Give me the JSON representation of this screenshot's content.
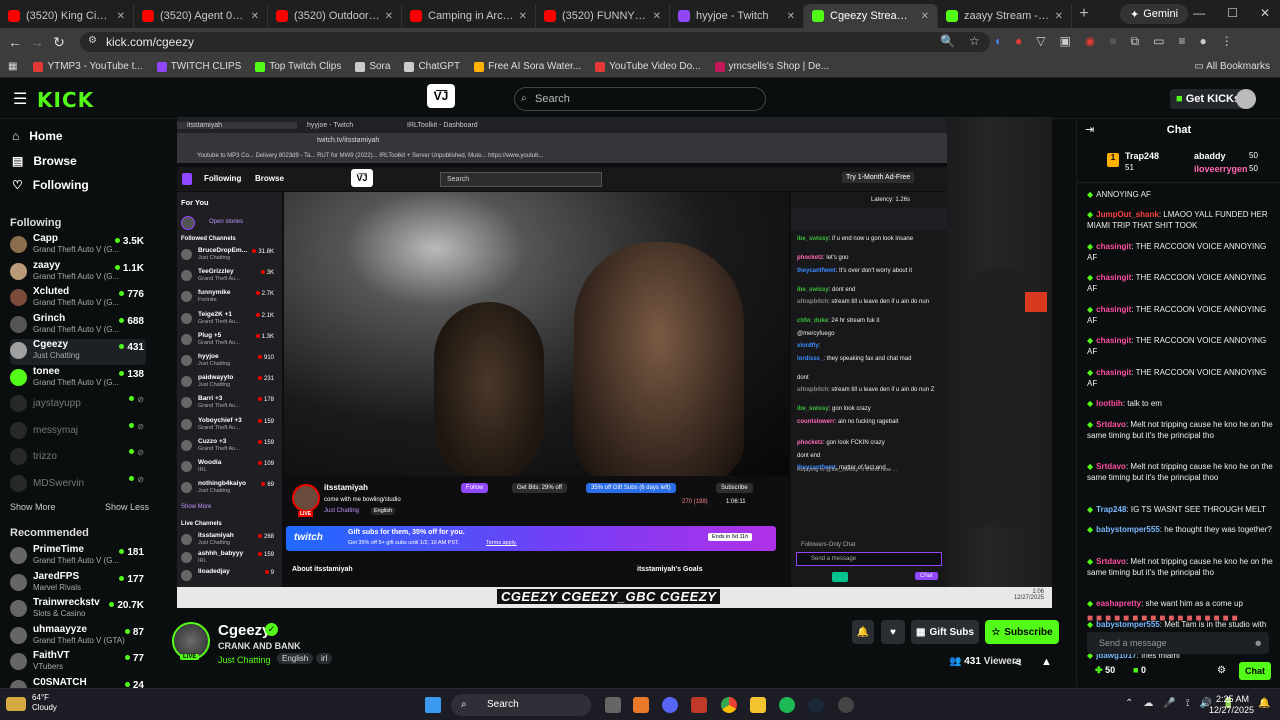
{
  "browser": {
    "tabs": [
      {
        "title": "(3520) King Cid - YouTube",
        "fav": "#ff0000"
      },
      {
        "title": "(3520) Agent 00 Everything",
        "fav": "#ff0000"
      },
      {
        "title": "(3520) Outdoor Boys - Y",
        "fav": "#ff0000"
      },
      {
        "title": "Camping in Arctic Circle",
        "fav": "#ff0000"
      },
      {
        "title": "(3520) FUNNYMIKE RE",
        "fav": "#ff0000"
      },
      {
        "title": "hyyjoe - Twitch",
        "fav": "#9146ff"
      },
      {
        "title": "Cgeezy Stream - W",
        "fav": "#53fc18"
      },
      {
        "title": "zaayy Stream - Watch L",
        "fav": "#53fc18"
      }
    ],
    "gemini": "Gemini",
    "url": "kick.com/cgeezy",
    "bookmarks": [
      {
        "label": "YTMP3 - YouTube t...",
        "c": "#e53935"
      },
      {
        "label": "TWITCH CLIPS",
        "c": "#9146ff"
      },
      {
        "label": "Top Twitch Clips",
        "c": "#53fc18"
      },
      {
        "label": "Sora",
        "c": "#ccc"
      },
      {
        "label": "ChatGPT",
        "c": "#ccc"
      },
      {
        "label": "Free AI Sora Water...",
        "c": "#ffb300"
      },
      {
        "label": "YouTube Video Do...",
        "c": "#e53935"
      },
      {
        "label": "ymcsells's Shop | De...",
        "c": "#c2185b"
      }
    ],
    "all_bookmarks": "All Bookmarks"
  },
  "kick": {
    "logo": "KICK",
    "search_placeholder": "Search",
    "get_kicks": "Get KICKs",
    "nav": {
      "home": "Home",
      "browse": "Browse",
      "following": "Following"
    },
    "following_header": "Following",
    "following": [
      {
        "name": "Capp",
        "game": "Grand Theft Auto V (G...",
        "viewers": "3.5K",
        "live": true
      },
      {
        "name": "zaayy",
        "game": "Grand Theft Auto V (G...",
        "viewers": "1.1K",
        "live": true
      },
      {
        "name": "Xcluted",
        "game": "Grand Theft Auto V (G...",
        "viewers": "776",
        "live": true
      },
      {
        "name": "Grinch",
        "game": "Grand Theft Auto V (G...",
        "viewers": "688",
        "live": true
      },
      {
        "name": "Cgeezy",
        "game": "Just Chatting",
        "viewers": "431",
        "live": true
      },
      {
        "name": "tonee",
        "game": "Grand Theft Auto V (G...",
        "viewers": "138",
        "live": true
      },
      {
        "name": "jaystayupp",
        "live": false
      },
      {
        "name": "messymaj",
        "live": false
      },
      {
        "name": "trizzo",
        "live": false
      },
      {
        "name": "MDSwervin",
        "live": false
      }
    ],
    "show_more": "Show More",
    "show_less": "Show Less",
    "recommended_header": "Recommended",
    "recommended": [
      {
        "name": "PrimeTime",
        "game": "Grand Theft Auto V (G...",
        "viewers": "181"
      },
      {
        "name": "JaredFPS",
        "game": "Marvel Rivals",
        "viewers": "177"
      },
      {
        "name": "Trainwreckstv",
        "game": "Slots & Casino",
        "viewers": "20.7K"
      },
      {
        "name": "uhmaayyze",
        "game": "Grand Theft Auto V (GTA)",
        "viewers": "87"
      },
      {
        "name": "FaithVT",
        "game": "VTubers",
        "viewers": "77"
      },
      {
        "name": "C0SNATCH",
        "game": "",
        "viewers": "24"
      }
    ]
  },
  "inner": {
    "tabs": [
      "hyyjoe - Twitch",
      "IRLToolkit - Dashboard",
      "itsstamiyah"
    ],
    "url": "twitch.tv/itsstamiyah",
    "bookmarks": "Youtube to MP3 Co...   Delivery 8023d9 - Ta...   RUT for MW9 (2022)...   IRLToolkit + Server   Unpublished, Mute...   https://www.youtub...",
    "following": "Following",
    "browse": "Browse",
    "search": "Search",
    "ad_free": "Try 1-Month Ad-Free",
    "for_you": "For You",
    "open_stories": "Open stories",
    "followed_channels": "Followed Channels",
    "live_channels": "Live Channels",
    "show_more": "Show More",
    "channels": [
      {
        "name": "BruceDropEm...",
        "game": "Just Chatting",
        "viewers": "31.8K"
      },
      {
        "name": "TeeGrizzley",
        "game": "Grand Theft Au...",
        "viewers": "3K"
      },
      {
        "name": "funnymike",
        "game": "Fortnite",
        "viewers": "2.7K"
      },
      {
        "name": "Teige2K +1",
        "game": "Grand Theft Au...",
        "viewers": "2.1K"
      },
      {
        "name": "Plug +5",
        "game": "Grand Theft Au...",
        "viewers": "1.3K"
      },
      {
        "name": "hyyjoe",
        "game": "Just Chatting",
        "viewers": "910"
      },
      {
        "name": "paidwayyto",
        "game": "Just Chatting",
        "viewers": "231"
      },
      {
        "name": "Barri +3",
        "game": "Grand Theft Au...",
        "viewers": "178"
      },
      {
        "name": "Yoboychief +3",
        "game": "Grand Theft Au...",
        "viewers": "159"
      },
      {
        "name": "Cuzzo +3",
        "game": "Grand Theft Au...",
        "viewers": "159"
      },
      {
        "name": "Woodia",
        "game": "IRL",
        "viewers": "109"
      },
      {
        "name": "nothingb4kaiyo",
        "game": "Just Chatting",
        "viewers": "69"
      }
    ],
    "live_list": [
      {
        "name": "itsstamiyah",
        "game": "Just Chatting",
        "viewers": "268"
      },
      {
        "name": "ashhh_babyyy",
        "game": "IRL",
        "viewers": "159"
      },
      {
        "name": "lloadedjay",
        "game": "",
        "viewers": "9"
      }
    ],
    "streamer": "itsstamiyah",
    "stream_title": "come with me bowling/studio",
    "category": "Just Chatting",
    "lang": "English",
    "follow": "Follow",
    "get_bits": "Get Bits: 29% off",
    "gift_subs": "35% off Gift Subs (6 days left)",
    "subscribe": "Subscribe",
    "viewers": "270 (198)",
    "uptime": "1:06:11",
    "banner_title": "Gift subs for them, 35% off for you.",
    "banner_sub": "Get 35% off 5+ gift subs until 1/2, 10 AM PST.",
    "banner_terms": "Terms apply.",
    "banner_ends": "Ends in 6d 11h",
    "about": "About itsstamiyah",
    "goals": "itsstamiyah's Goals",
    "latency": "Latency: 1.26s",
    "chat": [
      {
        "u": "ibe_swissy",
        "c": "#3bbd3b",
        "m": "if u end now u gon look insane"
      },
      {
        "u": "phocketz",
        "c": "#ff69b4",
        "m": "let's goo"
      },
      {
        "u": "theycantfwmt",
        "c": "#3a8bfd",
        "m": "It's over don't worry about it"
      },
      {
        "u": "ibe_swissy",
        "c": "#3bbd3b",
        "m": "dont end"
      },
      {
        "u": "ultrapbitch",
        "c": "#888",
        "m": "stream till u leave den if u ain do nun"
      },
      {
        "u": "cbfw_duke",
        "c": "#3bbd3b",
        "m": "24 hr stream fuk it"
      },
      {
        "u": "",
        "c": "#3a8bfd",
        "m": "@mercyfuego"
      },
      {
        "u": "xlordfly",
        "c": "#3a8bfd",
        "m": ""
      },
      {
        "u": "lordisss_",
        "c": "#3a8bfd",
        "m": "they speaking fax and chat mad"
      },
      {
        "u": "",
        "c": "#ff4040",
        "m": "dont"
      },
      {
        "u": "ultrapbitch",
        "c": "#888",
        "m": "stream till u leave den if u ain do nun Z"
      },
      {
        "u": "ibe_swissy",
        "c": "#3bbd3b",
        "m": "gon look crazy"
      },
      {
        "u": "countslowerr",
        "c": "#ff69b4",
        "m": "ain no fucking ragebait"
      },
      {
        "u": "phocketz",
        "c": "#ff69b4",
        "m": "gon look FCKIN crazy"
      },
      {
        "u": "",
        "c": "#ff4040",
        "m": "dont end"
      },
      {
        "u": "theycantfwmt",
        "c": "#3a8bfd",
        "m": "matter of fact end"
      }
    ],
    "reply_to": "Replying to @ibe_swissy: if u end now ...",
    "followers_only": "Followers-Only Chat",
    "send_message": "Send a message",
    "chat_btn": "Chat",
    "clock": "12:00\n12/27/2025"
  },
  "overlay_text": "CGEEZY  CGEEZY_GBC  CGEEZY",
  "stream": {
    "name": "Cgeezy",
    "title": "CRANK AND BANK",
    "category": "Just Chatting",
    "tags": [
      "English",
      "irl"
    ],
    "gift_subs": "Gift Subs",
    "subscribe": "Subscribe",
    "viewers": "431",
    "viewers_label": "Viewers",
    "live": "LIVE"
  },
  "chat": {
    "header": "Chat",
    "pinned": [
      {
        "rank": "1",
        "name": "Trap248",
        "count": "51"
      },
      {
        "name": "abaddy",
        "count": "50"
      },
      {
        "name": "iloveerrygen",
        "count": "50"
      }
    ],
    "messages": [
      {
        "u": "",
        "c": "#53fc18",
        "m": "ANNOYING AF"
      },
      {
        "u": "JumpOut_shank",
        "c": "#ff4040",
        "m": "LMAOO YALL FUNDED HER MIAMI TRIP THAT SHIT TOOK"
      },
      {
        "u": "chasingit",
        "c": "#ff4fa0",
        "m": "THE RACCOON VOICE ANNOYING AF"
      },
      {
        "u": "chasingit",
        "c": "#ff4fa0",
        "m": "THE RACCOON VOICE ANNOYING AF"
      },
      {
        "u": "chasingit",
        "c": "#ff4fa0",
        "m": "THE RACCOON VOICE ANNOYING AF"
      },
      {
        "u": "chasingit",
        "c": "#ff4fa0",
        "m": "THE RACCOON VOICE ANNOYING AF"
      },
      {
        "u": "chasingit",
        "c": "#ff4fa0",
        "m": "THE RACCOON VOICE ANNOYING AF"
      },
      {
        "u": "lootbih",
        "c": "#ff4fa0",
        "m": "talk to em"
      },
      {
        "u": "Srtdavo",
        "c": "#ff4fa0",
        "m": "Melt not tripping cause he kno he on the same timing but it's the principal tho"
      },
      {
        "u": "Srtdavo",
        "c": "#ff4fa0",
        "m": "Melt not tripping cause he kno he on the same timing but it's the principal thoo"
      },
      {
        "u": "Trap248",
        "c": "#7ab8ff",
        "m": "IG TS WASNT SEE THROUGH MELT"
      },
      {
        "u": "babystomper555",
        "c": "#7ab8ff",
        "m": "he thought they was together?"
      },
      {
        "u": "Srtdavo",
        "c": "#ff4fa0",
        "m": "Melt not tripping cause he kno he on the same timing but it's the principal tho"
      },
      {
        "u": "eashapretty",
        "c": "#ff4fa0",
        "m": "she want him as a come up"
      },
      {
        "u": "babystomper555",
        "c": "#7ab8ff",
        "m": "Melt Tam is in the studio with niggas let it go 5"
      },
      {
        "u": "jdawg1017",
        "c": "#7ab8ff",
        "m": "fries miami"
      }
    ],
    "input_placeholder": "Send a message",
    "points": "50",
    "kicks": "0",
    "chat_btn": "Chat"
  },
  "taskbar": {
    "temp": "64°F",
    "cond": "Cloudy",
    "search": "Search",
    "time": "2:25 AM",
    "date": "12/27/2025"
  }
}
